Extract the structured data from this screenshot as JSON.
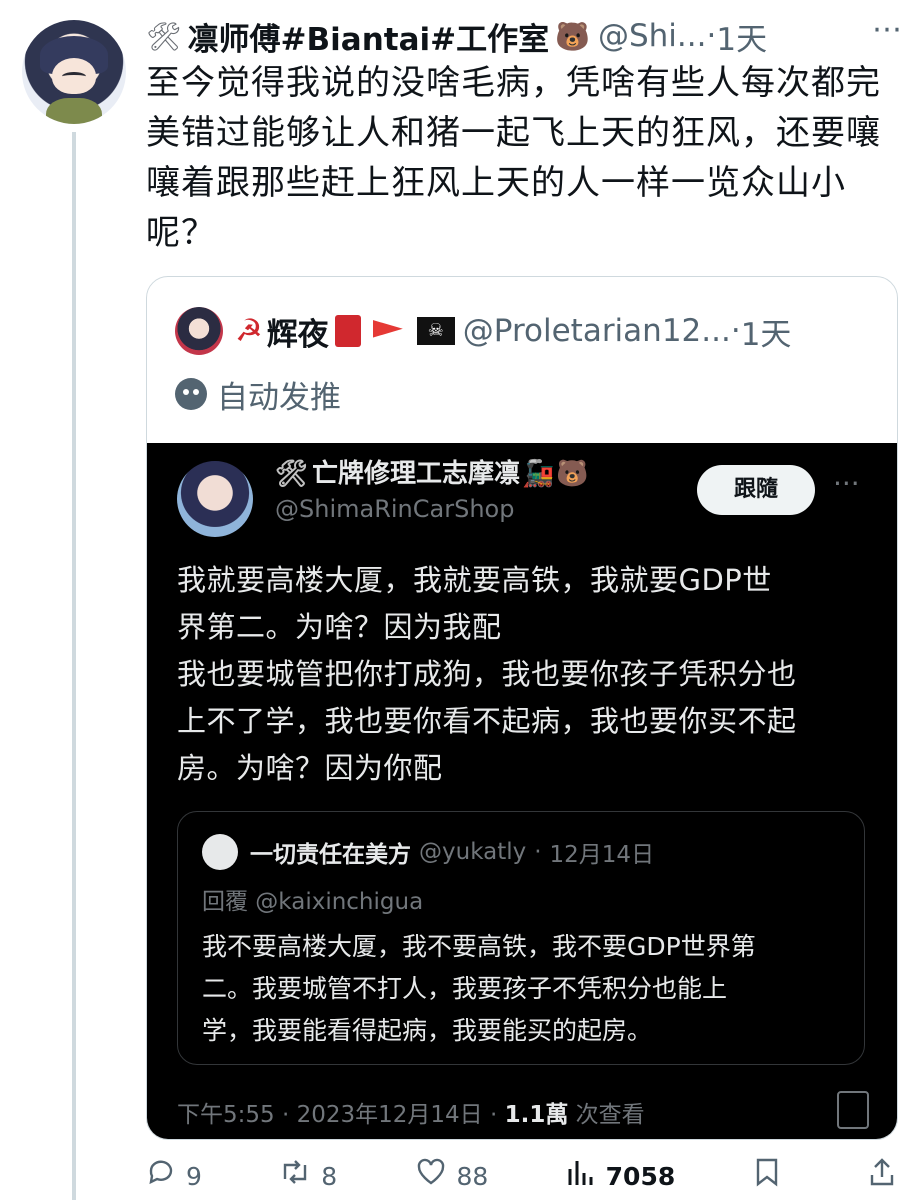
{
  "tweet": {
    "display_name": "凛师傅#Biantai#工作室",
    "tools_emoji": "🛠",
    "bear_emoji": "🐻",
    "username": "@Shi...",
    "dot": "·",
    "time": "1天",
    "more_icon": "⋯",
    "text": "至今觉得我说的没啥毛病，凭啥有些人每次都完美错过能够让人和猪一起飞上天的狂风，还要嚷嚷着跟那些赶上狂风上天的人一样一览众山小呢？"
  },
  "quote": {
    "display_name": "辉夜",
    "hammer_emoji": "☭",
    "pirate_emoji": "☠",
    "username": "@Proletarian12...",
    "dot": "·",
    "time": "1天",
    "auto_label": "自动发推"
  },
  "embedded": {
    "display_name": "亡牌修理工志摩凛",
    "tools_emoji": "🛠",
    "train_emoji": "🚂",
    "bear_emoji": "🐻",
    "handle": "@ShimaRinCarShop",
    "follow_label": "跟隨",
    "more_icon": "···",
    "text_line1": "我就要高楼大厦，我就要高铁，我就要GDP世",
    "text_line2": "界第二。为啥？因为我配",
    "text_line3": "我也要城管把你打成狗，我也要你孩子凭积分也",
    "text_line4": "上不了学，我也要你看不起病，我也要你买不起",
    "text_line5": "房。为啥？因为你配",
    "inner": {
      "display_name": "一切责任在美方",
      "username": "@yukatly",
      "dot": "·",
      "time": "12月14日",
      "reply": "回覆 @kaixinchigua",
      "text_line1": "我不要高楼大厦，我不要高铁，我不要GDP世界第",
      "text_line2": "二。我要城管不打人，我要孩子不凭积分也能上",
      "text_line3": "学，我要能看得起病，我要能买的起房。"
    },
    "footer_time": "下午5:55 · 2023年12月14日 · ",
    "footer_views": "1.1萬",
    "footer_views_label": " 次查看"
  },
  "actions": {
    "reply_count": "9",
    "retweet_count": "8",
    "like_count": "88",
    "view_count": "7058"
  },
  "icons": {
    "reply": "reply-icon",
    "retweet": "retweet-icon",
    "like": "heart-icon",
    "views": "views-icon",
    "bookmark": "bookmark-icon",
    "share": "share-icon"
  }
}
